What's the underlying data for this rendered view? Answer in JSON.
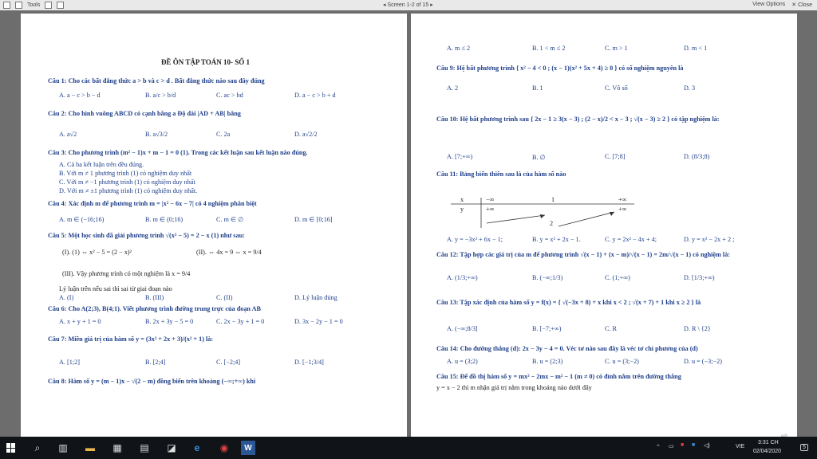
{
  "toolbar": {
    "tools": "Tools",
    "screen": "Screen 1-2 of 15",
    "view_options": "View Options",
    "close": "Close"
  },
  "left_page": {
    "title": "ĐỀ ÔN TẬP TOÁN 10- SỐ 1",
    "lines": [
      "Câu 1: Cho các bất đẳng thức a > b và c > d . Bất đẳng thức nào sau đây đúng",
      "A. a − c > b − d",
      "B. a/c > b/d",
      "C. ac > bd",
      "D. a − c > b + d",
      "Câu 2: Cho hình vuông ABCD có cạnh bằng a Độ dài |AD + AB| bằng",
      "A. a√2",
      "B. a√3/2",
      "C. 2a",
      "D. a√2/2",
      "Câu 3: Cho phương trình (m² − 1)x + m − 1 = 0 (1). Trong các kết luận sau kết luận nào đúng.",
      "A. Cả ba kết luận trên đều đúng.",
      "B. Với m ≠ 1 phương trình (1) có nghiệm duy nhất",
      "C. Với m ≠ −1 phương trình (1) có nghiệm duy nhất",
      "D. Với m ≠ ±1 phương trình (1) có nghiệm duy nhất.",
      "Câu 4: Xác định m để phương trình m = |x² − 6x − 7| có 4 nghiệm phân biệt",
      "A. m ∈ (−16;16)",
      "B. m ∈ (0;16)",
      "C. m ∈ ∅",
      "D. m ∈ [0;16]",
      "Câu 5: Một học sinh đã giải phương trình √(x² − 5) = 2 − x (1) như sau:",
      "(I). (1) ⇔ x² − 5 = (2 − x)²",
      "(II). ⇔ 4x = 9 ⇔ x = 9/4",
      "(III). Vậy phương trình có một nghiệm là x = 9/4",
      "Lý luận trên nếu sai thì sai từ giai đoạn nào",
      "A. (I)",
      "B. (III)",
      "C. (II)",
      "D. Lý luận đúng",
      "Câu 6: Cho A(2;3), B(4;1). Viết phương trình đường trung trực của đoạn AB",
      "A. x + y + 1 = 0",
      "B. 2x + 3y − 5 = 0",
      "C. 2x − 3y + 1 = 0",
      "D. 3x − 2y − 1 = 0",
      "Câu 7: Miền giá trị của hàm số y = (3x² + 2x + 3)/(x² + 1) là:",
      "A. [1;2]",
      "B. [2;4]",
      "C. [−2;4]",
      "D. [−1;3/4]",
      "Câu 8: Hàm số y = (m − 1)x − √(2 − m) đồng biến trên khoảng (−∞;+∞) khi"
    ]
  },
  "right_page": {
    "lines": [
      "A. m ≤ 2",
      "B. 1 < m ≤ 2",
      "C. m > 1",
      "D. m < 1",
      "Câu 9: Hệ bất phương trình { x² − 4 < 0 ; (x − 1)(x² + 5x + 4) ≥ 0 } có số nghiệm nguyên là",
      "A. 2",
      "B. 1",
      "C. Vô số",
      "D. 3",
      "Câu 10: Hệ bất phương trình sau { 2x − 1 ≥ 3(x − 3) ; (2 − x)/2 < x − 3 ; √(x − 3) ≥ 2 } có tập nghiệm là:",
      "A. [7;+∞)",
      "B. ∅",
      "C. [7;8]",
      "D. (8/3;8)",
      "Câu 11: Bảng biến thiên sau là của hàm số nào",
      "A. y = −3x² + 6x − 1;",
      "B. y = x² + 2x − 1.",
      "C. y = 2x² − 4x + 4;",
      "D. y = x² − 2x + 2 ;",
      "Câu 12: Tập hợp các giá trị của m để phương trình √(x − 1) + (x − m)/√(x − 1) = 2m/√(x − 1) có nghiệm là:",
      "A. (1/3;+∞)",
      "B. (−∞;1/3)",
      "C. (1;+∞)",
      "D. [1/3;+∞)",
      "Câu 13: Tập xác định của hàm số y = f(x) = { √(−3x + 8) + x khi x < 2 ; √(x + 7) + 1 khi x ≥ 2 } là",
      "A. (−∞;8/3]",
      "B. [−7;+∞)",
      "C. R",
      "D. R \\ {2}",
      "Câu 14: Cho đường thẳng (d): 2x − 3y − 4 = 0. Véc tơ nào sau đây là véc tơ chỉ phương của (d)",
      "A. u = (3;2)",
      "B. u = (2;3)",
      "C. u = (3;−2)",
      "D. u = (−3;−2)",
      "Câu 15: Để đồ thị hàm số y = mx² − 2mx − m² − 1 (m ≠ 0) có đỉnh nằm trên đường thẳng",
      "y = x − 2 thì m nhận giá trị nằm trong khoảng nào dưới đây"
    ],
    "table": {
      "x_label": "x",
      "y_label": "y",
      "x_values": [
        "−∞",
        "1",
        "+∞"
      ],
      "y_values": [
        "+∞",
        "2",
        "+∞"
      ]
    }
  },
  "taskbar": {
    "time": "3:31 CH",
    "date": "02/04/2020",
    "lang": "VIE",
    "badge": "5"
  }
}
